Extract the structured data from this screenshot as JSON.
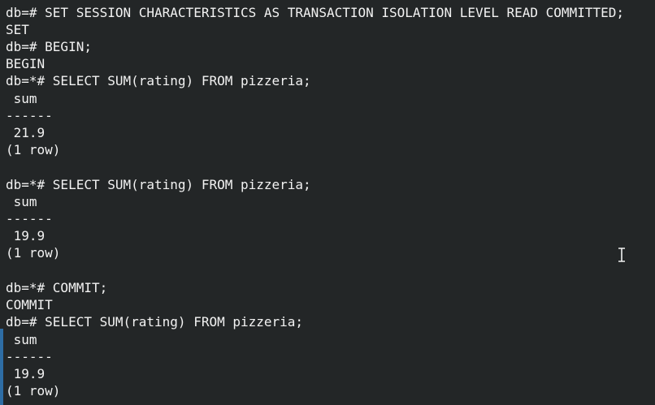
{
  "terminal": {
    "lines": [
      "db=# SET SESSION CHARACTERISTICS AS TRANSACTION ISOLATION LEVEL READ COMMITTED;",
      "SET",
      "db=# BEGIN;",
      "BEGIN",
      "db=*# SELECT SUM(rating) FROM pizzeria;",
      " sum",
      "------",
      " 21.9",
      "(1 row)",
      "",
      "db=*# SELECT SUM(rating) FROM pizzeria;",
      " sum",
      "------",
      " 19.9",
      "(1 row)",
      "",
      "db=*# COMMIT;",
      "COMMIT",
      "db=# SELECT SUM(rating) FROM pizzeria;",
      " sum",
      "------",
      " 19.9",
      "(1 row)"
    ]
  }
}
